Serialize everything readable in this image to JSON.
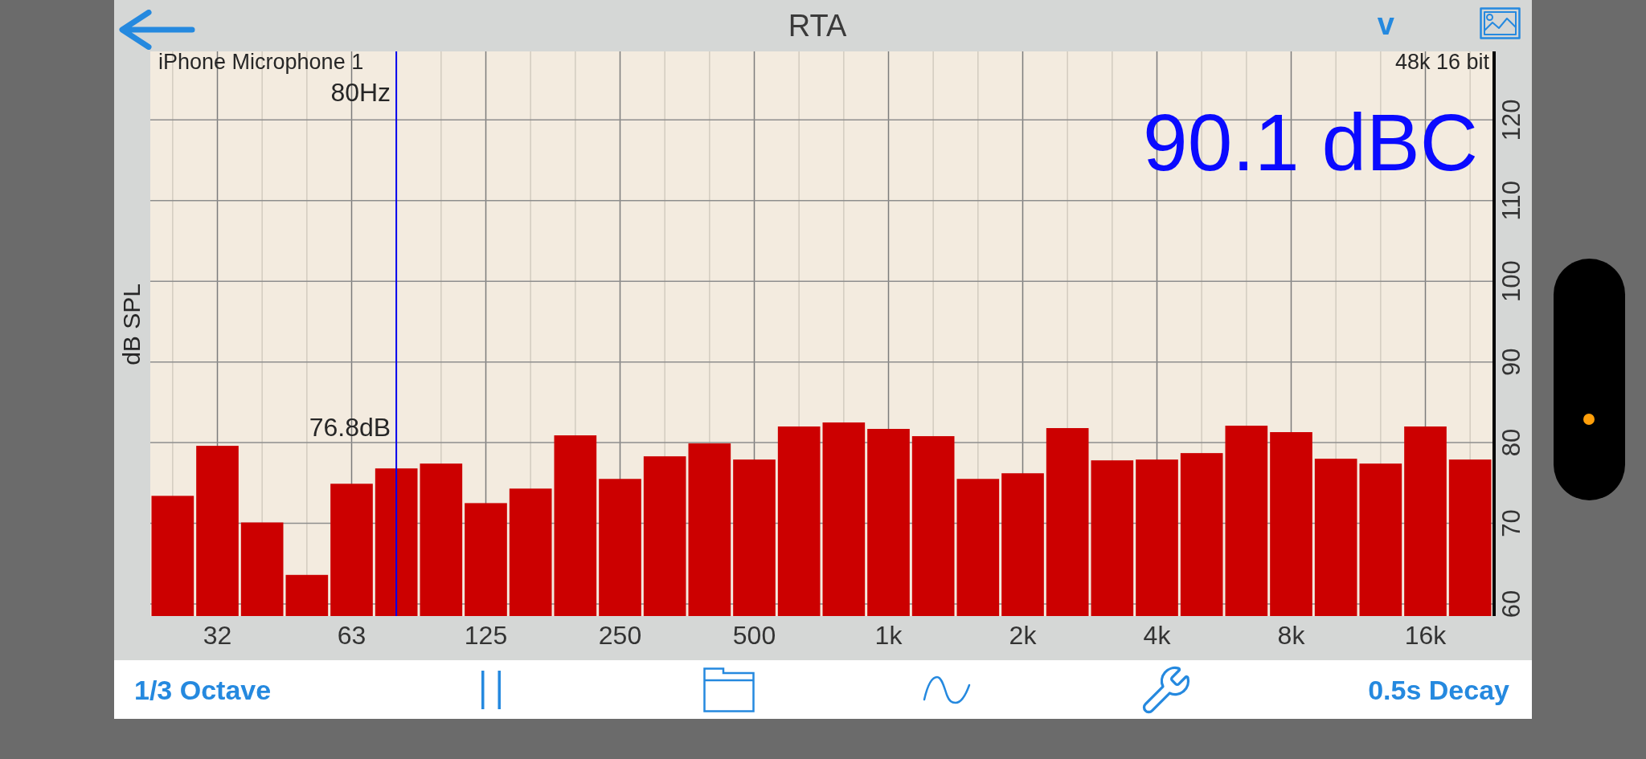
{
  "nav_bar": {
    "title": "RTA",
    "menu_button": "v"
  },
  "spectrum": {
    "input_device": "iPhone Microphone 1",
    "sample_format": "48k 16 bit",
    "reading": "90.1 dBC",
    "cursor": {
      "level": 0.1833
    },
    "chart_data": {
      "type": "bar",
      "ylabel": "dB SPL",
      "categories": [
        null,
        "32",
        null,
        null,
        "63",
        null,
        null,
        "125",
        null,
        null,
        "250",
        null,
        null,
        "500",
        null,
        null,
        "1k",
        null,
        null,
        "2k",
        null,
        null,
        "4k",
        null,
        null,
        "8k",
        null,
        null,
        "16k",
        null
      ],
      "values": [
        73.4,
        79.6,
        70.1,
        63.6,
        74.9,
        76.8,
        77.4,
        72.5,
        74.3,
        80.9,
        75.5,
        78.3,
        79.9,
        77.9,
        82.0,
        82.5,
        81.7,
        80.8,
        75.5,
        76.2,
        81.8,
        77.8,
        77.9,
        78.7,
        82.1,
        81.3,
        78.0,
        77.4,
        82.0,
        77.9
      ],
      "yticks": [
        60,
        70,
        80,
        90,
        100,
        110,
        120
      ],
      "ylim": [
        58.5,
        128.5
      ],
      "grid": true,
      "annotations": [
        "80Hz",
        "76.8dB"
      ]
    }
  },
  "toolbar": {
    "bands_button": "1/3 Octave",
    "decay_button": "0.5s Decay"
  }
}
